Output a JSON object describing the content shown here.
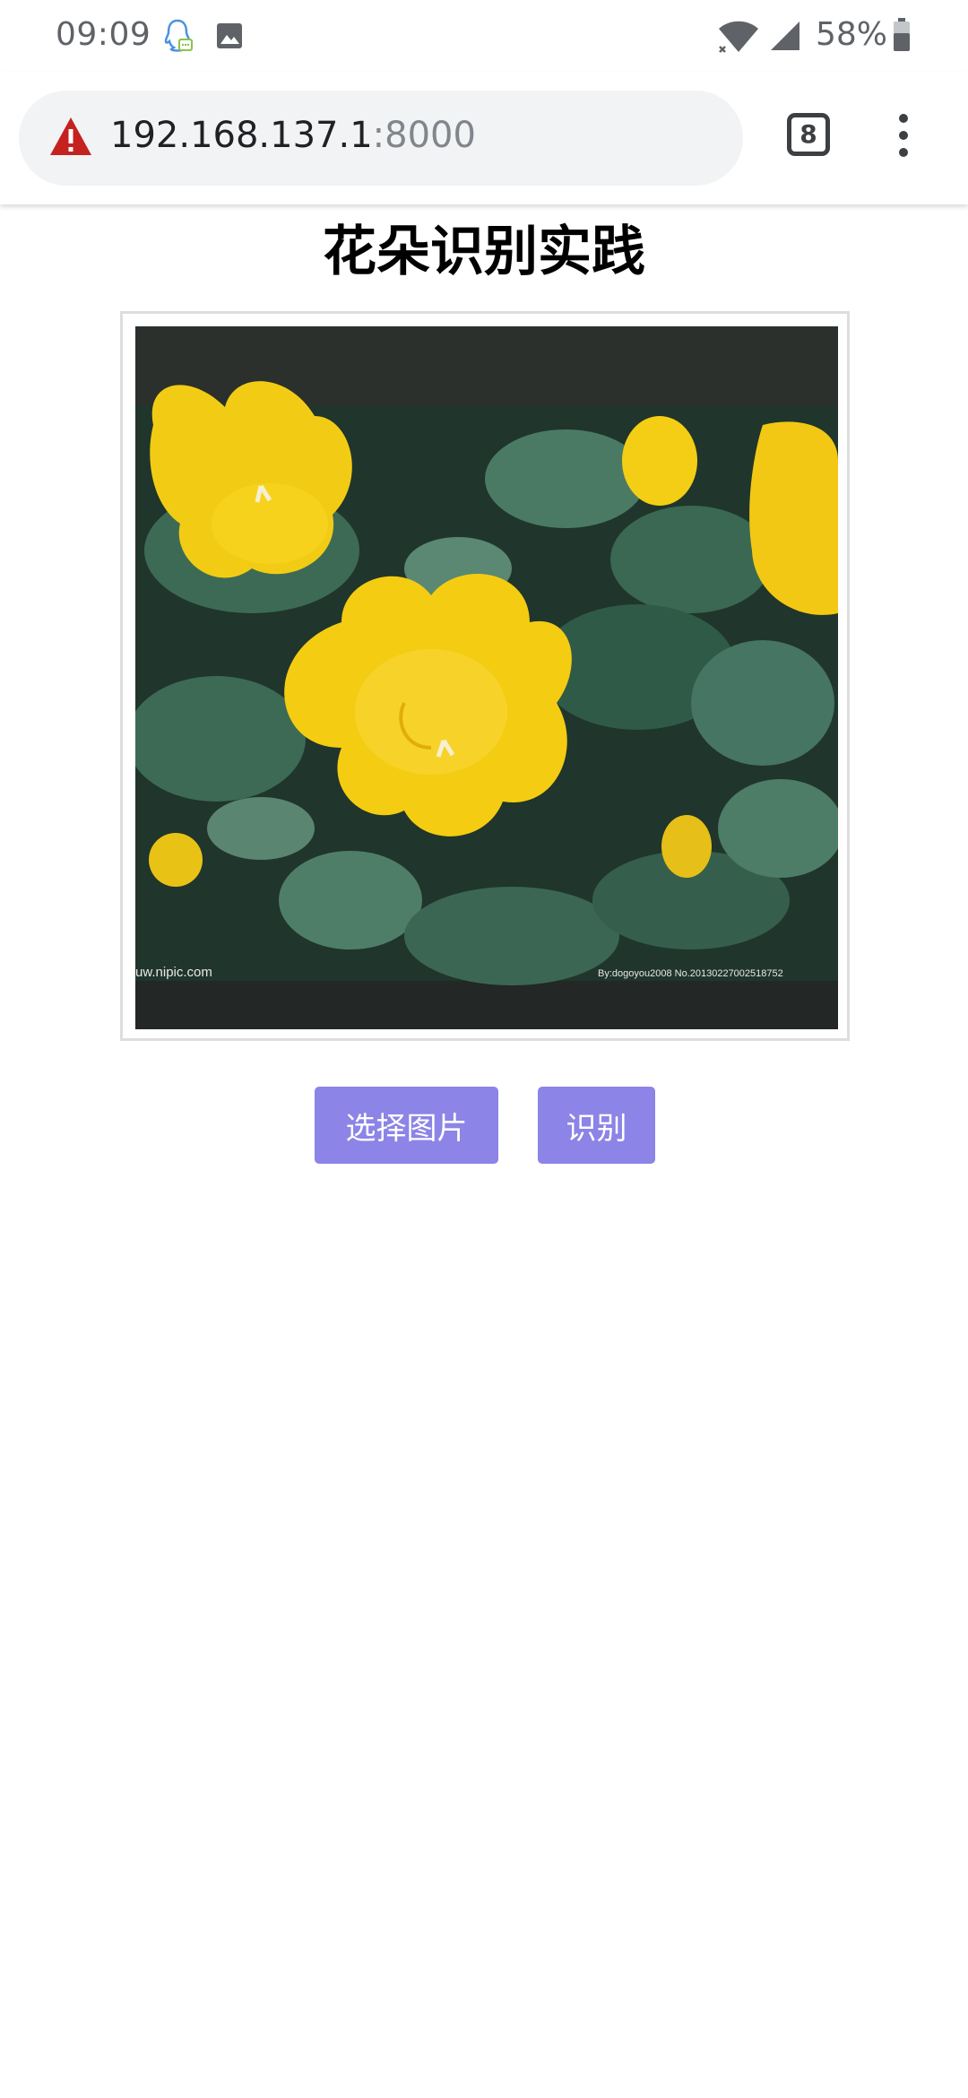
{
  "status_bar": {
    "time": "09:09",
    "battery": "58%",
    "icons": [
      "qq-icon",
      "image-icon",
      "wifi-icon",
      "signal-icon",
      "battery-icon"
    ]
  },
  "browser": {
    "url_host": "192.168.137.1",
    "url_port": ":8000",
    "tab_count": "8",
    "warning_color": "#c5221f"
  },
  "page": {
    "title": "花朵识别实践",
    "choose_image_label": "选择图片",
    "identify_label": "识别",
    "button_color": "#8c84e6",
    "photo": {
      "watermark_left": "uw.nipic.com",
      "watermark_right": "By:dogoyou2008 No.20130227002518752"
    }
  }
}
